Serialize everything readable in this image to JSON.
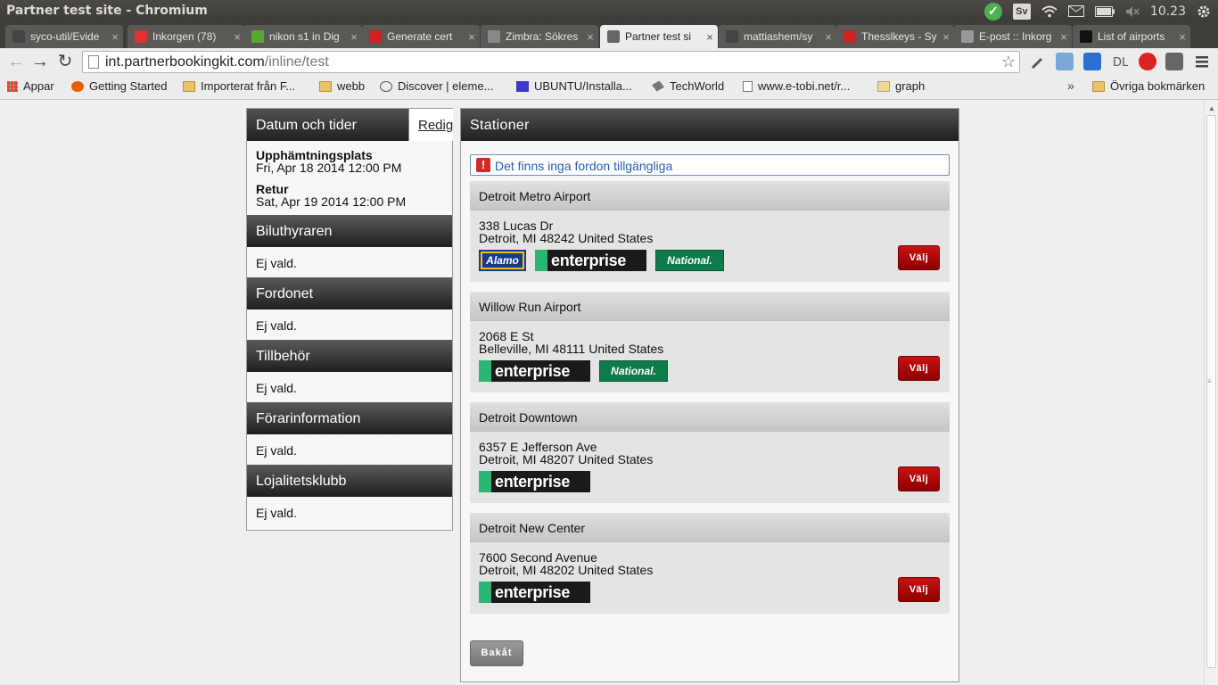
{
  "window": {
    "title": "Partner test site - Chromium"
  },
  "tray": {
    "ime": "Sv",
    "time": "10.23"
  },
  "tabs": [
    {
      "title": "syco-util/Evide",
      "fav": "#444"
    },
    {
      "title": "Inkorgen (78)",
      "fav": "#d33"
    },
    {
      "title": "nikon s1 in Dig",
      "fav": "#5a3"
    },
    {
      "title": "Generate cert",
      "fav": "#c22"
    },
    {
      "title": "Zimbra: Sökres",
      "fav": "#888"
    },
    {
      "title": "Partner test si",
      "fav": "#666"
    },
    {
      "title": "mattiashem/sy",
      "fav": "#444"
    },
    {
      "title": "Thesslkeys - Sy",
      "fav": "#c22"
    },
    {
      "title": "E-post :: Inkorg",
      "fav": "#999"
    },
    {
      "title": "List of airports",
      "fav": "#111"
    }
  ],
  "toolbar": {
    "url_host": "int.partnerbookingkit.com",
    "url_path": "/inline/test"
  },
  "bookmarks": [
    {
      "label": "Appar"
    },
    {
      "label": "Getting Started"
    },
    {
      "label": "Importerat från F..."
    },
    {
      "label": "webb"
    },
    {
      "label": "Discover | eleme..."
    },
    {
      "label": "UBUNTU/Installa..."
    },
    {
      "label": "TechWorld"
    },
    {
      "label": "www.e-tobi.net/r..."
    },
    {
      "label": "graph"
    }
  ],
  "bookmarks_other": "Övriga bokmärken",
  "left": {
    "title": "Datum och tider",
    "edit_label": "Redigera",
    "pickup_label": "Upphämtningsplats",
    "pickup_date": "Fri, Apr 18 2014 12:00 PM",
    "return_label": "Retur",
    "return_date": "Sat, Apr 19 2014 12:00 PM",
    "sections": [
      {
        "title": "Biluthyraren",
        "value": "Ej vald."
      },
      {
        "title": "Fordonet",
        "value": "Ej vald."
      },
      {
        "title": "Tillbehör",
        "value": "Ej vald."
      },
      {
        "title": "Förarinformation",
        "value": "Ej vald."
      },
      {
        "title": "Lojalitetsklubb",
        "value": "Ej vald."
      }
    ]
  },
  "right": {
    "title": "Stationer",
    "alert": "Det finns inga fordon tillgängliga",
    "select_label": "Välj",
    "back_label": "Bakåt",
    "stations": [
      {
        "name": "Detroit Metro Airport",
        "street": "338 Lucas Dr",
        "city": "Detroit, MI 48242 United States",
        "brands": [
          "Alamo",
          "enterprise",
          "National."
        ]
      },
      {
        "name": "Willow Run Airport",
        "street": "2068 E St",
        "city": "Belleville, MI 48111 United States",
        "brands": [
          "enterprise",
          "National."
        ]
      },
      {
        "name": "Detroit Downtown",
        "street": "6357 E Jefferson Ave",
        "city": "Detroit, MI 48207 United States",
        "brands": [
          "enterprise"
        ]
      },
      {
        "name": "Detroit New Center",
        "street": "7600 Second Avenue",
        "city": "Detroit, MI 48202 United States",
        "brands": [
          "enterprise"
        ]
      }
    ]
  }
}
